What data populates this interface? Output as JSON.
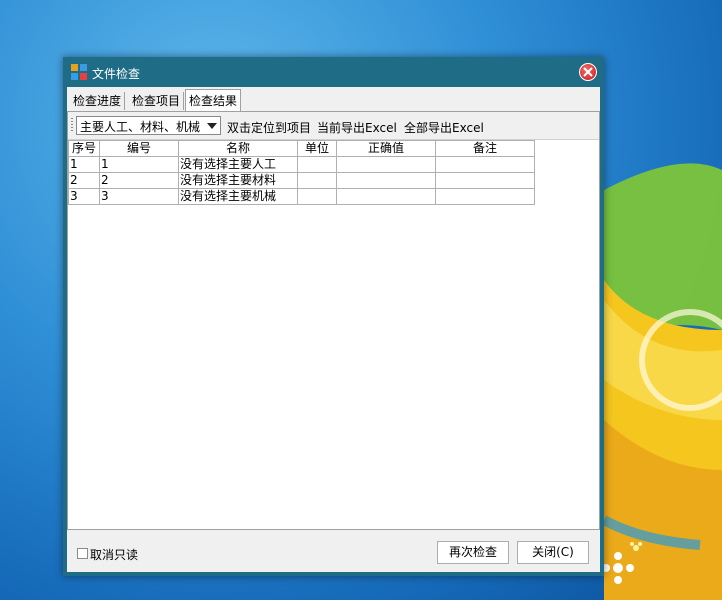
{
  "window": {
    "title": "文件检查",
    "close_icon": "close-icon"
  },
  "tabs": [
    {
      "label": "检查进度",
      "active": false
    },
    {
      "label": "检查项目",
      "active": false
    },
    {
      "label": "检查结果",
      "active": true
    }
  ],
  "toolbar": {
    "combo_value": "主要人工、材料、机械",
    "btn_locate": "双击定位到项目",
    "btn_export_current": "当前导出Excel",
    "btn_export_all": "全部导出Excel"
  },
  "grid": {
    "columns": [
      "序号",
      "编号",
      "名称",
      "单位",
      "正确值",
      "备注"
    ],
    "rows": [
      [
        "1",
        "1",
        "没有选择主要人工",
        "",
        "",
        ""
      ],
      [
        "2",
        "2",
        "没有选择主要材料",
        "",
        "",
        ""
      ],
      [
        "3",
        "3",
        "没有选择主要机械",
        "",
        "",
        ""
      ]
    ]
  },
  "footer": {
    "readonly_label": "取消只读",
    "readonly_checked": false,
    "recheck_label": "再次检查",
    "close_label": "关闭(C)"
  },
  "colors": {
    "window_frame": "#1f6c86",
    "close_button": "#c81e1e",
    "desktop": "#2f8fd6"
  }
}
